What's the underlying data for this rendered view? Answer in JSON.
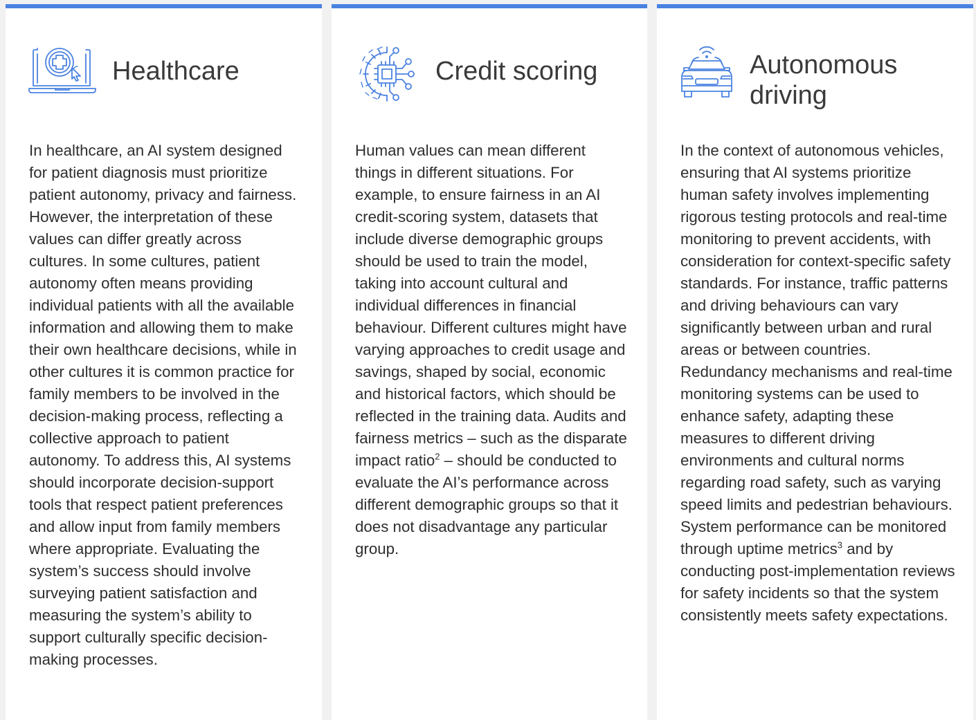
{
  "colors": {
    "accent": "#4a82e0",
    "icon": "#4a82e0",
    "background": "#f1f1f1",
    "card": "#ffffff"
  },
  "cards": [
    {
      "icon": "laptop-medical-icon",
      "title": "Healthcare",
      "body": "In healthcare, an AI system designed for patient diagnosis must prioritize patient autonomy, privacy and fairness. However, the interpretation of these values can differ greatly across cultures. In some cultures, patient autonomy often means providing individual patients with all the available information and allowing them to make their own healthcare decisions, while in other cultures it is common practice for family members to be involved in the decision-making process, reflecting a collective approach to patient autonomy. To address this, AI systems should incorporate decision-support tools that respect patient preferences and allow input from family members where appropriate. Evaluating the system’s success should involve surveying patient satisfaction and measuring the system’s ability to support culturally specific decision-making processes."
    },
    {
      "icon": "chip-gear-icon",
      "title": "Credit scoring",
      "body_part1": "Human values can mean different things in different situations. For example, to ensure fairness in an AI credit-scoring system, datasets that include diverse demographic groups should be used to train the model, taking into account cultural and individual differences in financial behaviour. Different cultures might have varying approaches to credit usage and savings, shaped by social, economic and historical factors, which should be reflected in the training data. Audits and fairness metrics – such as the disparate impact ratio",
      "footnote": "2",
      "body_part2": " – should be conducted to evaluate the AI’s performance across different demographic groups so that it does not disadvantage any particular group."
    },
    {
      "icon": "connected-car-icon",
      "title": "Autonomous driving",
      "body_part1": "In the context of autonomous vehicles, ensuring that AI systems prioritize human safety involves implementing rigorous testing protocols and real-time monitoring to prevent accidents, with consideration for context-specific safety standards. For instance, traffic patterns and driving behaviours can vary significantly between urban and rural areas or between countries. Redundancy mechanisms and real-time monitoring systems can be used to enhance safety, adapting these measures to different driving environments and cultural norms regarding road safety, such as varying speed limits and pedestrian behaviours. System performance can be monitored through uptime metrics",
      "footnote": "3",
      "body_part2": " and by conducting post-implementation reviews for safety incidents so that the system consistently meets safety expectations."
    }
  ]
}
